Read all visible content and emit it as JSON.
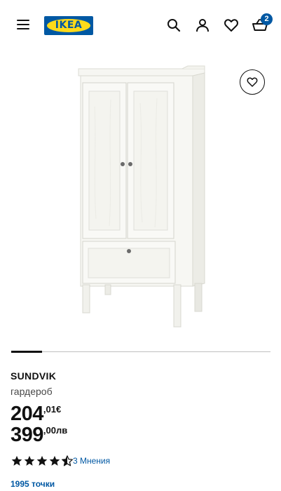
{
  "header": {
    "logo_text": "IKEA",
    "menu_icon": "hamburger-menu-icon",
    "search_icon": "search-icon",
    "account_icon": "user-icon",
    "wishlist_icon": "heart-icon",
    "cart_icon": "basket-icon",
    "cart_count": "2",
    "brand_blue": "#0058a3",
    "brand_yellow": "#ffda1a"
  },
  "product": {
    "image_icon": "wardrobe-image",
    "favorite_icon": "heart-icon",
    "gallery_progress": 0.12,
    "name": "SUNDVIK",
    "type": "гардероб",
    "price_eur": {
      "integer": "204",
      "decimal": ",01€"
    },
    "price_bgn": {
      "integer": "399",
      "decimal": ",00лв"
    },
    "rating": 4.5,
    "rating_max": 5,
    "reviews_text": "3 Мнения",
    "points_text": "1995 точки"
  }
}
